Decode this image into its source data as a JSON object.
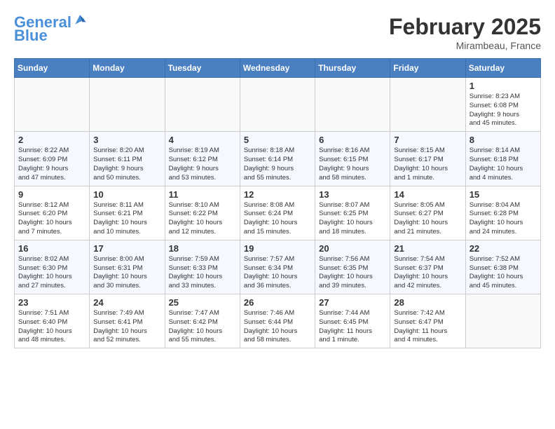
{
  "header": {
    "logo_line1": "General",
    "logo_line2": "Blue",
    "month_title": "February 2025",
    "location": "Mirambeau, France"
  },
  "weekdays": [
    "Sunday",
    "Monday",
    "Tuesday",
    "Wednesday",
    "Thursday",
    "Friday",
    "Saturday"
  ],
  "weeks": [
    [
      {
        "day": "",
        "info": ""
      },
      {
        "day": "",
        "info": ""
      },
      {
        "day": "",
        "info": ""
      },
      {
        "day": "",
        "info": ""
      },
      {
        "day": "",
        "info": ""
      },
      {
        "day": "",
        "info": ""
      },
      {
        "day": "1",
        "info": "Sunrise: 8:23 AM\nSunset: 6:08 PM\nDaylight: 9 hours\nand 45 minutes."
      }
    ],
    [
      {
        "day": "2",
        "info": "Sunrise: 8:22 AM\nSunset: 6:09 PM\nDaylight: 9 hours\nand 47 minutes."
      },
      {
        "day": "3",
        "info": "Sunrise: 8:20 AM\nSunset: 6:11 PM\nDaylight: 9 hours\nand 50 minutes."
      },
      {
        "day": "4",
        "info": "Sunrise: 8:19 AM\nSunset: 6:12 PM\nDaylight: 9 hours\nand 53 minutes."
      },
      {
        "day": "5",
        "info": "Sunrise: 8:18 AM\nSunset: 6:14 PM\nDaylight: 9 hours\nand 55 minutes."
      },
      {
        "day": "6",
        "info": "Sunrise: 8:16 AM\nSunset: 6:15 PM\nDaylight: 9 hours\nand 58 minutes."
      },
      {
        "day": "7",
        "info": "Sunrise: 8:15 AM\nSunset: 6:17 PM\nDaylight: 10 hours\nand 1 minute."
      },
      {
        "day": "8",
        "info": "Sunrise: 8:14 AM\nSunset: 6:18 PM\nDaylight: 10 hours\nand 4 minutes."
      }
    ],
    [
      {
        "day": "9",
        "info": "Sunrise: 8:12 AM\nSunset: 6:20 PM\nDaylight: 10 hours\nand 7 minutes."
      },
      {
        "day": "10",
        "info": "Sunrise: 8:11 AM\nSunset: 6:21 PM\nDaylight: 10 hours\nand 10 minutes."
      },
      {
        "day": "11",
        "info": "Sunrise: 8:10 AM\nSunset: 6:22 PM\nDaylight: 10 hours\nand 12 minutes."
      },
      {
        "day": "12",
        "info": "Sunrise: 8:08 AM\nSunset: 6:24 PM\nDaylight: 10 hours\nand 15 minutes."
      },
      {
        "day": "13",
        "info": "Sunrise: 8:07 AM\nSunset: 6:25 PM\nDaylight: 10 hours\nand 18 minutes."
      },
      {
        "day": "14",
        "info": "Sunrise: 8:05 AM\nSunset: 6:27 PM\nDaylight: 10 hours\nand 21 minutes."
      },
      {
        "day": "15",
        "info": "Sunrise: 8:04 AM\nSunset: 6:28 PM\nDaylight: 10 hours\nand 24 minutes."
      }
    ],
    [
      {
        "day": "16",
        "info": "Sunrise: 8:02 AM\nSunset: 6:30 PM\nDaylight: 10 hours\nand 27 minutes."
      },
      {
        "day": "17",
        "info": "Sunrise: 8:00 AM\nSunset: 6:31 PM\nDaylight: 10 hours\nand 30 minutes."
      },
      {
        "day": "18",
        "info": "Sunrise: 7:59 AM\nSunset: 6:33 PM\nDaylight: 10 hours\nand 33 minutes."
      },
      {
        "day": "19",
        "info": "Sunrise: 7:57 AM\nSunset: 6:34 PM\nDaylight: 10 hours\nand 36 minutes."
      },
      {
        "day": "20",
        "info": "Sunrise: 7:56 AM\nSunset: 6:35 PM\nDaylight: 10 hours\nand 39 minutes."
      },
      {
        "day": "21",
        "info": "Sunrise: 7:54 AM\nSunset: 6:37 PM\nDaylight: 10 hours\nand 42 minutes."
      },
      {
        "day": "22",
        "info": "Sunrise: 7:52 AM\nSunset: 6:38 PM\nDaylight: 10 hours\nand 45 minutes."
      }
    ],
    [
      {
        "day": "23",
        "info": "Sunrise: 7:51 AM\nSunset: 6:40 PM\nDaylight: 10 hours\nand 48 minutes."
      },
      {
        "day": "24",
        "info": "Sunrise: 7:49 AM\nSunset: 6:41 PM\nDaylight: 10 hours\nand 52 minutes."
      },
      {
        "day": "25",
        "info": "Sunrise: 7:47 AM\nSunset: 6:42 PM\nDaylight: 10 hours\nand 55 minutes."
      },
      {
        "day": "26",
        "info": "Sunrise: 7:46 AM\nSunset: 6:44 PM\nDaylight: 10 hours\nand 58 minutes."
      },
      {
        "day": "27",
        "info": "Sunrise: 7:44 AM\nSunset: 6:45 PM\nDaylight: 11 hours\nand 1 minute."
      },
      {
        "day": "28",
        "info": "Sunrise: 7:42 AM\nSunset: 6:47 PM\nDaylight: 11 hours\nand 4 minutes."
      },
      {
        "day": "",
        "info": ""
      }
    ]
  ]
}
